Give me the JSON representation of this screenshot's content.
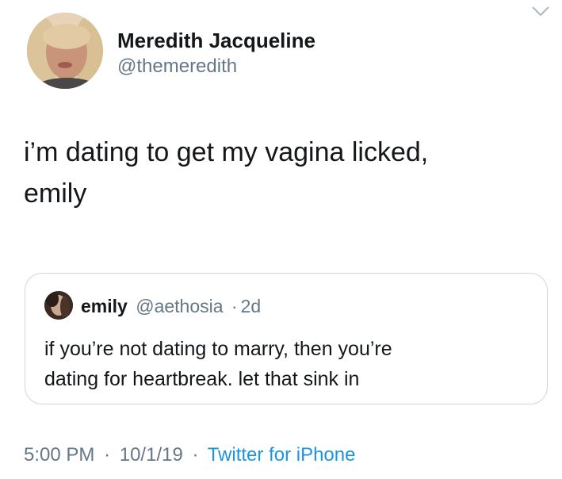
{
  "author": {
    "name": "Meredith Jacqueline",
    "handle": "@themeredith"
  },
  "tweet": {
    "text_lines": [
      "i’m dating to get my vagina licked,",
      "emily"
    ]
  },
  "quoted_tweet": {
    "name": "emily",
    "handle": "@aethosia",
    "separator": "·",
    "time": "2d",
    "text_lines": [
      "if you’re not dating to marry, then you’re",
      "dating for heartbreak. let that sink in"
    ]
  },
  "footer": {
    "time": "5:00 PM",
    "separator": "·",
    "date": "10/1/19",
    "source": "Twitter for iPhone"
  },
  "icons": {
    "more": "chevron-down-icon"
  },
  "colors": {
    "text": "#14171a",
    "secondary": "#657786",
    "link": "#1b95e0",
    "border": "#ccd6dd"
  }
}
